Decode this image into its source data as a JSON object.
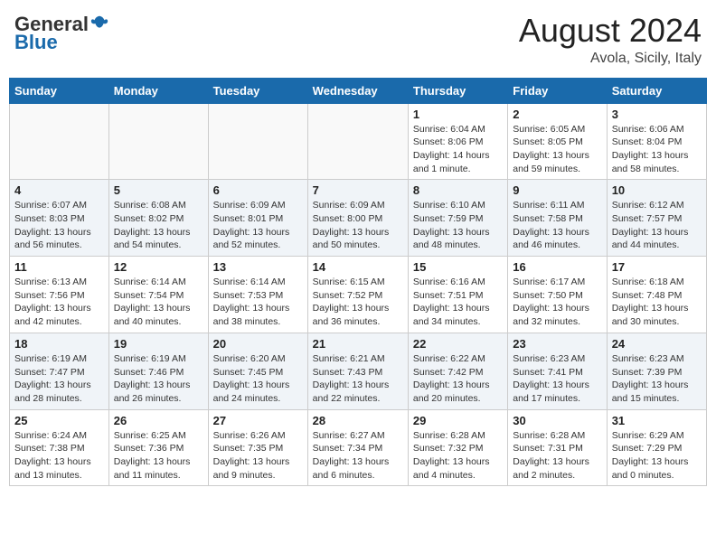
{
  "header": {
    "logo_general": "General",
    "logo_blue": "Blue",
    "month_year": "August 2024",
    "location": "Avola, Sicily, Italy"
  },
  "days_of_week": [
    "Sunday",
    "Monday",
    "Tuesday",
    "Wednesday",
    "Thursday",
    "Friday",
    "Saturday"
  ],
  "weeks": [
    [
      {
        "day": "",
        "info": ""
      },
      {
        "day": "",
        "info": ""
      },
      {
        "day": "",
        "info": ""
      },
      {
        "day": "",
        "info": ""
      },
      {
        "day": "1",
        "info": "Sunrise: 6:04 AM\nSunset: 8:06 PM\nDaylight: 14 hours\nand 1 minute."
      },
      {
        "day": "2",
        "info": "Sunrise: 6:05 AM\nSunset: 8:05 PM\nDaylight: 13 hours\nand 59 minutes."
      },
      {
        "day": "3",
        "info": "Sunrise: 6:06 AM\nSunset: 8:04 PM\nDaylight: 13 hours\nand 58 minutes."
      }
    ],
    [
      {
        "day": "4",
        "info": "Sunrise: 6:07 AM\nSunset: 8:03 PM\nDaylight: 13 hours\nand 56 minutes."
      },
      {
        "day": "5",
        "info": "Sunrise: 6:08 AM\nSunset: 8:02 PM\nDaylight: 13 hours\nand 54 minutes."
      },
      {
        "day": "6",
        "info": "Sunrise: 6:09 AM\nSunset: 8:01 PM\nDaylight: 13 hours\nand 52 minutes."
      },
      {
        "day": "7",
        "info": "Sunrise: 6:09 AM\nSunset: 8:00 PM\nDaylight: 13 hours\nand 50 minutes."
      },
      {
        "day": "8",
        "info": "Sunrise: 6:10 AM\nSunset: 7:59 PM\nDaylight: 13 hours\nand 48 minutes."
      },
      {
        "day": "9",
        "info": "Sunrise: 6:11 AM\nSunset: 7:58 PM\nDaylight: 13 hours\nand 46 minutes."
      },
      {
        "day": "10",
        "info": "Sunrise: 6:12 AM\nSunset: 7:57 PM\nDaylight: 13 hours\nand 44 minutes."
      }
    ],
    [
      {
        "day": "11",
        "info": "Sunrise: 6:13 AM\nSunset: 7:56 PM\nDaylight: 13 hours\nand 42 minutes."
      },
      {
        "day": "12",
        "info": "Sunrise: 6:14 AM\nSunset: 7:54 PM\nDaylight: 13 hours\nand 40 minutes."
      },
      {
        "day": "13",
        "info": "Sunrise: 6:14 AM\nSunset: 7:53 PM\nDaylight: 13 hours\nand 38 minutes."
      },
      {
        "day": "14",
        "info": "Sunrise: 6:15 AM\nSunset: 7:52 PM\nDaylight: 13 hours\nand 36 minutes."
      },
      {
        "day": "15",
        "info": "Sunrise: 6:16 AM\nSunset: 7:51 PM\nDaylight: 13 hours\nand 34 minutes."
      },
      {
        "day": "16",
        "info": "Sunrise: 6:17 AM\nSunset: 7:50 PM\nDaylight: 13 hours\nand 32 minutes."
      },
      {
        "day": "17",
        "info": "Sunrise: 6:18 AM\nSunset: 7:48 PM\nDaylight: 13 hours\nand 30 minutes."
      }
    ],
    [
      {
        "day": "18",
        "info": "Sunrise: 6:19 AM\nSunset: 7:47 PM\nDaylight: 13 hours\nand 28 minutes."
      },
      {
        "day": "19",
        "info": "Sunrise: 6:19 AM\nSunset: 7:46 PM\nDaylight: 13 hours\nand 26 minutes."
      },
      {
        "day": "20",
        "info": "Sunrise: 6:20 AM\nSunset: 7:45 PM\nDaylight: 13 hours\nand 24 minutes."
      },
      {
        "day": "21",
        "info": "Sunrise: 6:21 AM\nSunset: 7:43 PM\nDaylight: 13 hours\nand 22 minutes."
      },
      {
        "day": "22",
        "info": "Sunrise: 6:22 AM\nSunset: 7:42 PM\nDaylight: 13 hours\nand 20 minutes."
      },
      {
        "day": "23",
        "info": "Sunrise: 6:23 AM\nSunset: 7:41 PM\nDaylight: 13 hours\nand 17 minutes."
      },
      {
        "day": "24",
        "info": "Sunrise: 6:23 AM\nSunset: 7:39 PM\nDaylight: 13 hours\nand 15 minutes."
      }
    ],
    [
      {
        "day": "25",
        "info": "Sunrise: 6:24 AM\nSunset: 7:38 PM\nDaylight: 13 hours\nand 13 minutes."
      },
      {
        "day": "26",
        "info": "Sunrise: 6:25 AM\nSunset: 7:36 PM\nDaylight: 13 hours\nand 11 minutes."
      },
      {
        "day": "27",
        "info": "Sunrise: 6:26 AM\nSunset: 7:35 PM\nDaylight: 13 hours\nand 9 minutes."
      },
      {
        "day": "28",
        "info": "Sunrise: 6:27 AM\nSunset: 7:34 PM\nDaylight: 13 hours\nand 6 minutes."
      },
      {
        "day": "29",
        "info": "Sunrise: 6:28 AM\nSunset: 7:32 PM\nDaylight: 13 hours\nand 4 minutes."
      },
      {
        "day": "30",
        "info": "Sunrise: 6:28 AM\nSunset: 7:31 PM\nDaylight: 13 hours\nand 2 minutes."
      },
      {
        "day": "31",
        "info": "Sunrise: 6:29 AM\nSunset: 7:29 PM\nDaylight: 13 hours\nand 0 minutes."
      }
    ]
  ]
}
